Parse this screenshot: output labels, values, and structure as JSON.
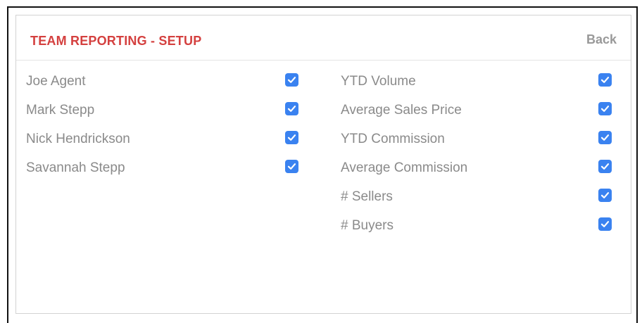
{
  "header": {
    "title": "TEAM REPORTING - SETUP",
    "back_label": "Back"
  },
  "colors": {
    "title": "#d4403f",
    "checkbox": "#3a82f0",
    "label": "#8a8a8a",
    "back": "#999999"
  },
  "agents": [
    {
      "label": "Joe Agent",
      "checked": true
    },
    {
      "label": "Mark Stepp",
      "checked": true
    },
    {
      "label": "Nick Hendrickson",
      "checked": true
    },
    {
      "label": "Savannah Stepp",
      "checked": true
    }
  ],
  "metrics": [
    {
      "label": "YTD Volume",
      "checked": true
    },
    {
      "label": "Average Sales Price",
      "checked": true
    },
    {
      "label": "YTD Commission",
      "checked": true
    },
    {
      "label": "Average Commission",
      "checked": true
    },
    {
      "label": "# Sellers",
      "checked": true
    },
    {
      "label": "# Buyers",
      "checked": true
    }
  ],
  "icons": {
    "checkbox": "checkmark-icon"
  }
}
